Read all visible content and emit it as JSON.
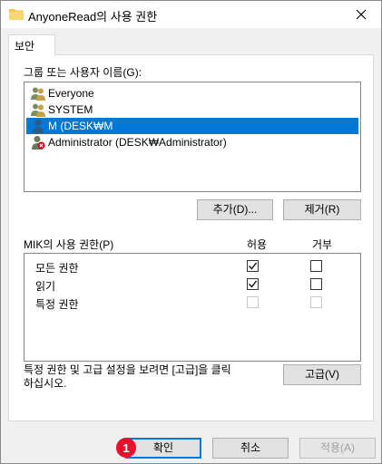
{
  "window": {
    "title": "AnyoneRead의 사용 권한",
    "icons": {
      "title": "folder-icon",
      "close": "close-icon"
    }
  },
  "tab": {
    "label": "보안"
  },
  "groups": {
    "label": "그룹 또는 사용자 이름(G):",
    "items": [
      {
        "name": "Everyone",
        "icon": "users-group-icon",
        "selected": false
      },
      {
        "name": "SYSTEM",
        "icon": "users-group-icon",
        "selected": false
      },
      {
        "name": "M (DESK₩M",
        "icon": "user-icon",
        "selected": true
      },
      {
        "name": "Administrator (DESK₩Administrator)",
        "icon": "admin-user-icon",
        "selected": false
      }
    ],
    "add_button": "추가(D)...",
    "remove_button": "제거(R)"
  },
  "permissions": {
    "label": "MIK의 사용 권한(P)",
    "allow_header": "허용",
    "deny_header": "거부",
    "rows": [
      {
        "name": "모든 권한",
        "allow": true,
        "deny": false,
        "disabled": false
      },
      {
        "name": "읽기",
        "allow": true,
        "deny": false,
        "disabled": false
      },
      {
        "name": "특정 권한",
        "allow": false,
        "deny": false,
        "disabled": true
      }
    ]
  },
  "advanced": {
    "text": "특정 권한 및 고급 설정을 보려면 [고급]을 클릭\n하십시오.",
    "button": "고급(V)"
  },
  "footer": {
    "badge": "1",
    "ok": "확인",
    "cancel": "취소",
    "apply": "적용(A)"
  },
  "colors": {
    "selection": "#0078d7",
    "badge": "#e8112d"
  }
}
